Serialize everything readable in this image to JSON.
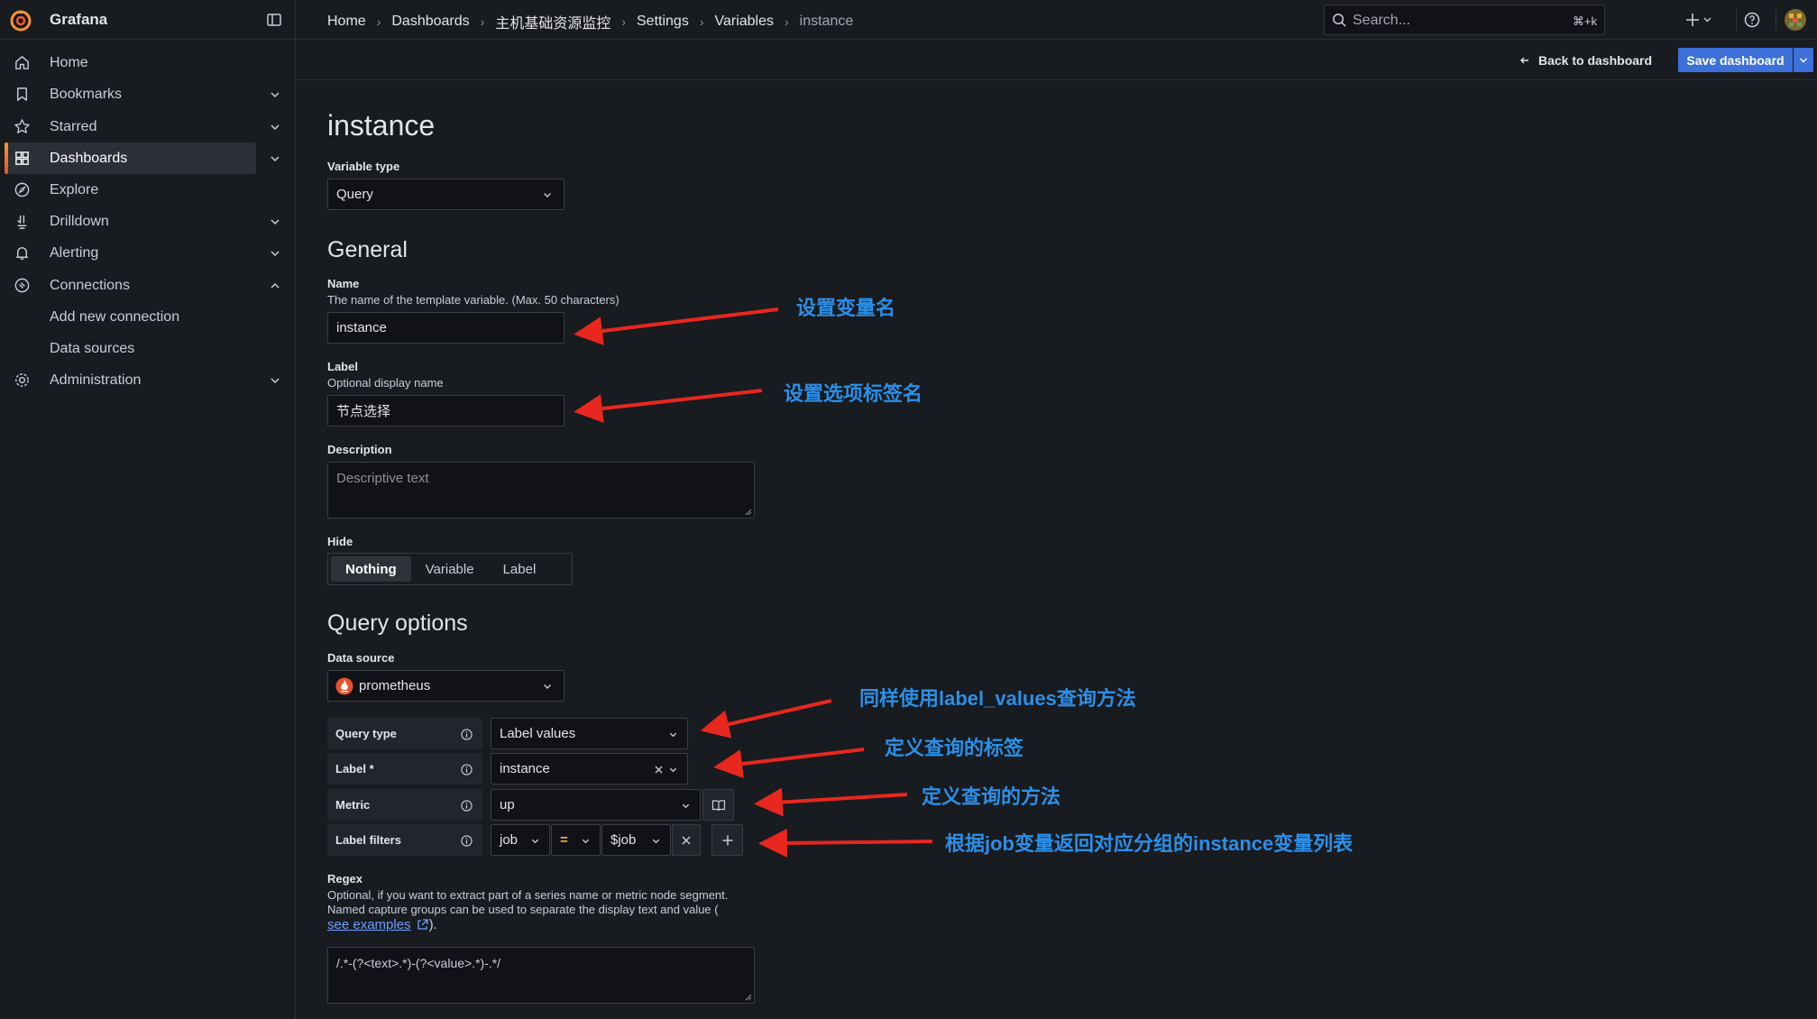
{
  "app": {
    "name": "Grafana"
  },
  "sidebar": {
    "items": [
      {
        "label": "Home"
      },
      {
        "label": "Bookmarks"
      },
      {
        "label": "Starred"
      },
      {
        "label": "Dashboards"
      },
      {
        "label": "Explore"
      },
      {
        "label": "Drilldown"
      },
      {
        "label": "Alerting"
      },
      {
        "label": "Connections"
      },
      {
        "label": "Add new connection"
      },
      {
        "label": "Data sources"
      },
      {
        "label": "Administration"
      }
    ],
    "active": "Dashboards"
  },
  "breadcrumb": [
    "Home",
    "Dashboards",
    "主机基础资源监控",
    "Settings",
    "Variables",
    "instance"
  ],
  "search": {
    "placeholder": "Search...",
    "shortcut": "⌘+k"
  },
  "toolbar": {
    "back_label": "Back to dashboard",
    "save_label": "Save dashboard"
  },
  "form": {
    "title": "instance",
    "variable_type": {
      "label": "Variable type",
      "value": "Query"
    },
    "general_heading": "General",
    "name": {
      "label": "Name",
      "description": "The name of the template variable. (Max. 50 characters)",
      "value": "instance"
    },
    "display_label": {
      "label": "Label",
      "description": "Optional display name",
      "value": "节点选择"
    },
    "description": {
      "label": "Description",
      "placeholder": "Descriptive text"
    },
    "hide": {
      "label": "Hide",
      "options": [
        "Nothing",
        "Variable",
        "Label"
      ],
      "selected": "Nothing"
    },
    "query_options_heading": "Query options",
    "data_source": {
      "label": "Data source",
      "value": "prometheus"
    },
    "query": {
      "query_type": {
        "label": "Query type",
        "value": "Label values"
      },
      "label": {
        "label": "Label *",
        "value": "instance"
      },
      "metric": {
        "label": "Metric",
        "value": "up"
      },
      "label_filters": {
        "label": "Label filters",
        "key": "job",
        "operator": "=",
        "value": "$job"
      }
    },
    "regex": {
      "label": "Regex",
      "description_line1": "Optional, if you want to extract part of a series name or metric node segment.",
      "description_line2": "Named capture groups can be used to separate the display text and value (",
      "link": "see examples",
      "suffix": ").",
      "value": "/.*-(?<text>.*)-(?<value>.*)-.*/"
    }
  },
  "annotations": {
    "name_note": "设置变量名",
    "label_note": "设置选项标签名",
    "query_type_note": "同样使用label_values查询方法",
    "label_field_note": "定义查询的标签",
    "metric_note": "定义查询的方法",
    "filters_note": "根据job变量返回对应分组的instance变量列表",
    "arrow_color": "#e8271f",
    "text_color": "#2b8fe8"
  },
  "colors": {
    "accent": "#3d71d9",
    "active_bar": "#f7933b",
    "background": "#181b1f"
  }
}
